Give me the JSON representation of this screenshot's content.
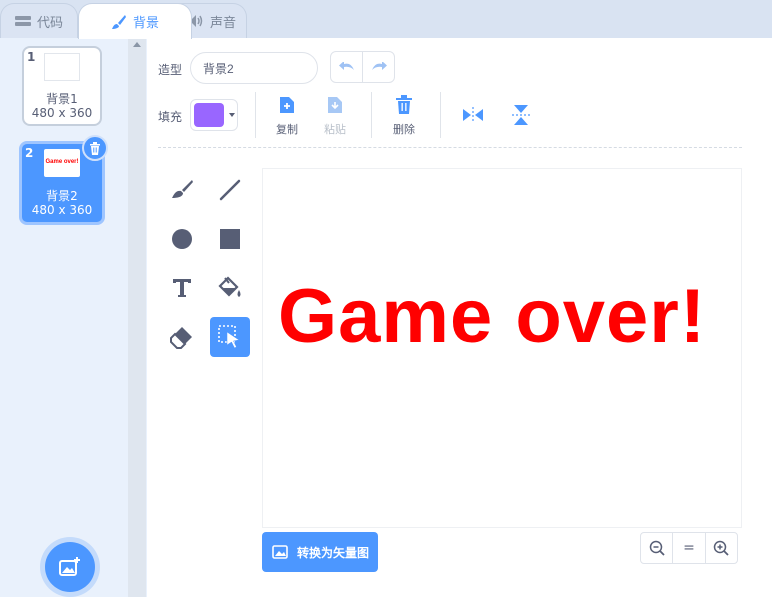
{
  "tabs": [
    {
      "label": "代码",
      "icon": "code-icon"
    },
    {
      "label": "背景",
      "icon": "brush-icon"
    },
    {
      "label": "声音",
      "icon": "speaker-icon"
    }
  ],
  "backdrops": [
    {
      "number": "1",
      "name": "背景1",
      "size": "480 x 360"
    },
    {
      "number": "2",
      "name": "背景2",
      "size": "480 x 360",
      "preview_text": "Game over!"
    }
  ],
  "editor": {
    "costume_label": "造型",
    "costume_name": "背景2",
    "fill_label": "填充",
    "fill_color": "#9966ff",
    "copy_label": "复制",
    "paste_label": "粘贴",
    "delete_label": "删除",
    "canvas_text": "Game over!",
    "canvas_text_color": "#ff0000",
    "convert_label": "转换为矢量图",
    "zoom_reset": "="
  },
  "colors": {
    "accent": "#4c97ff"
  }
}
